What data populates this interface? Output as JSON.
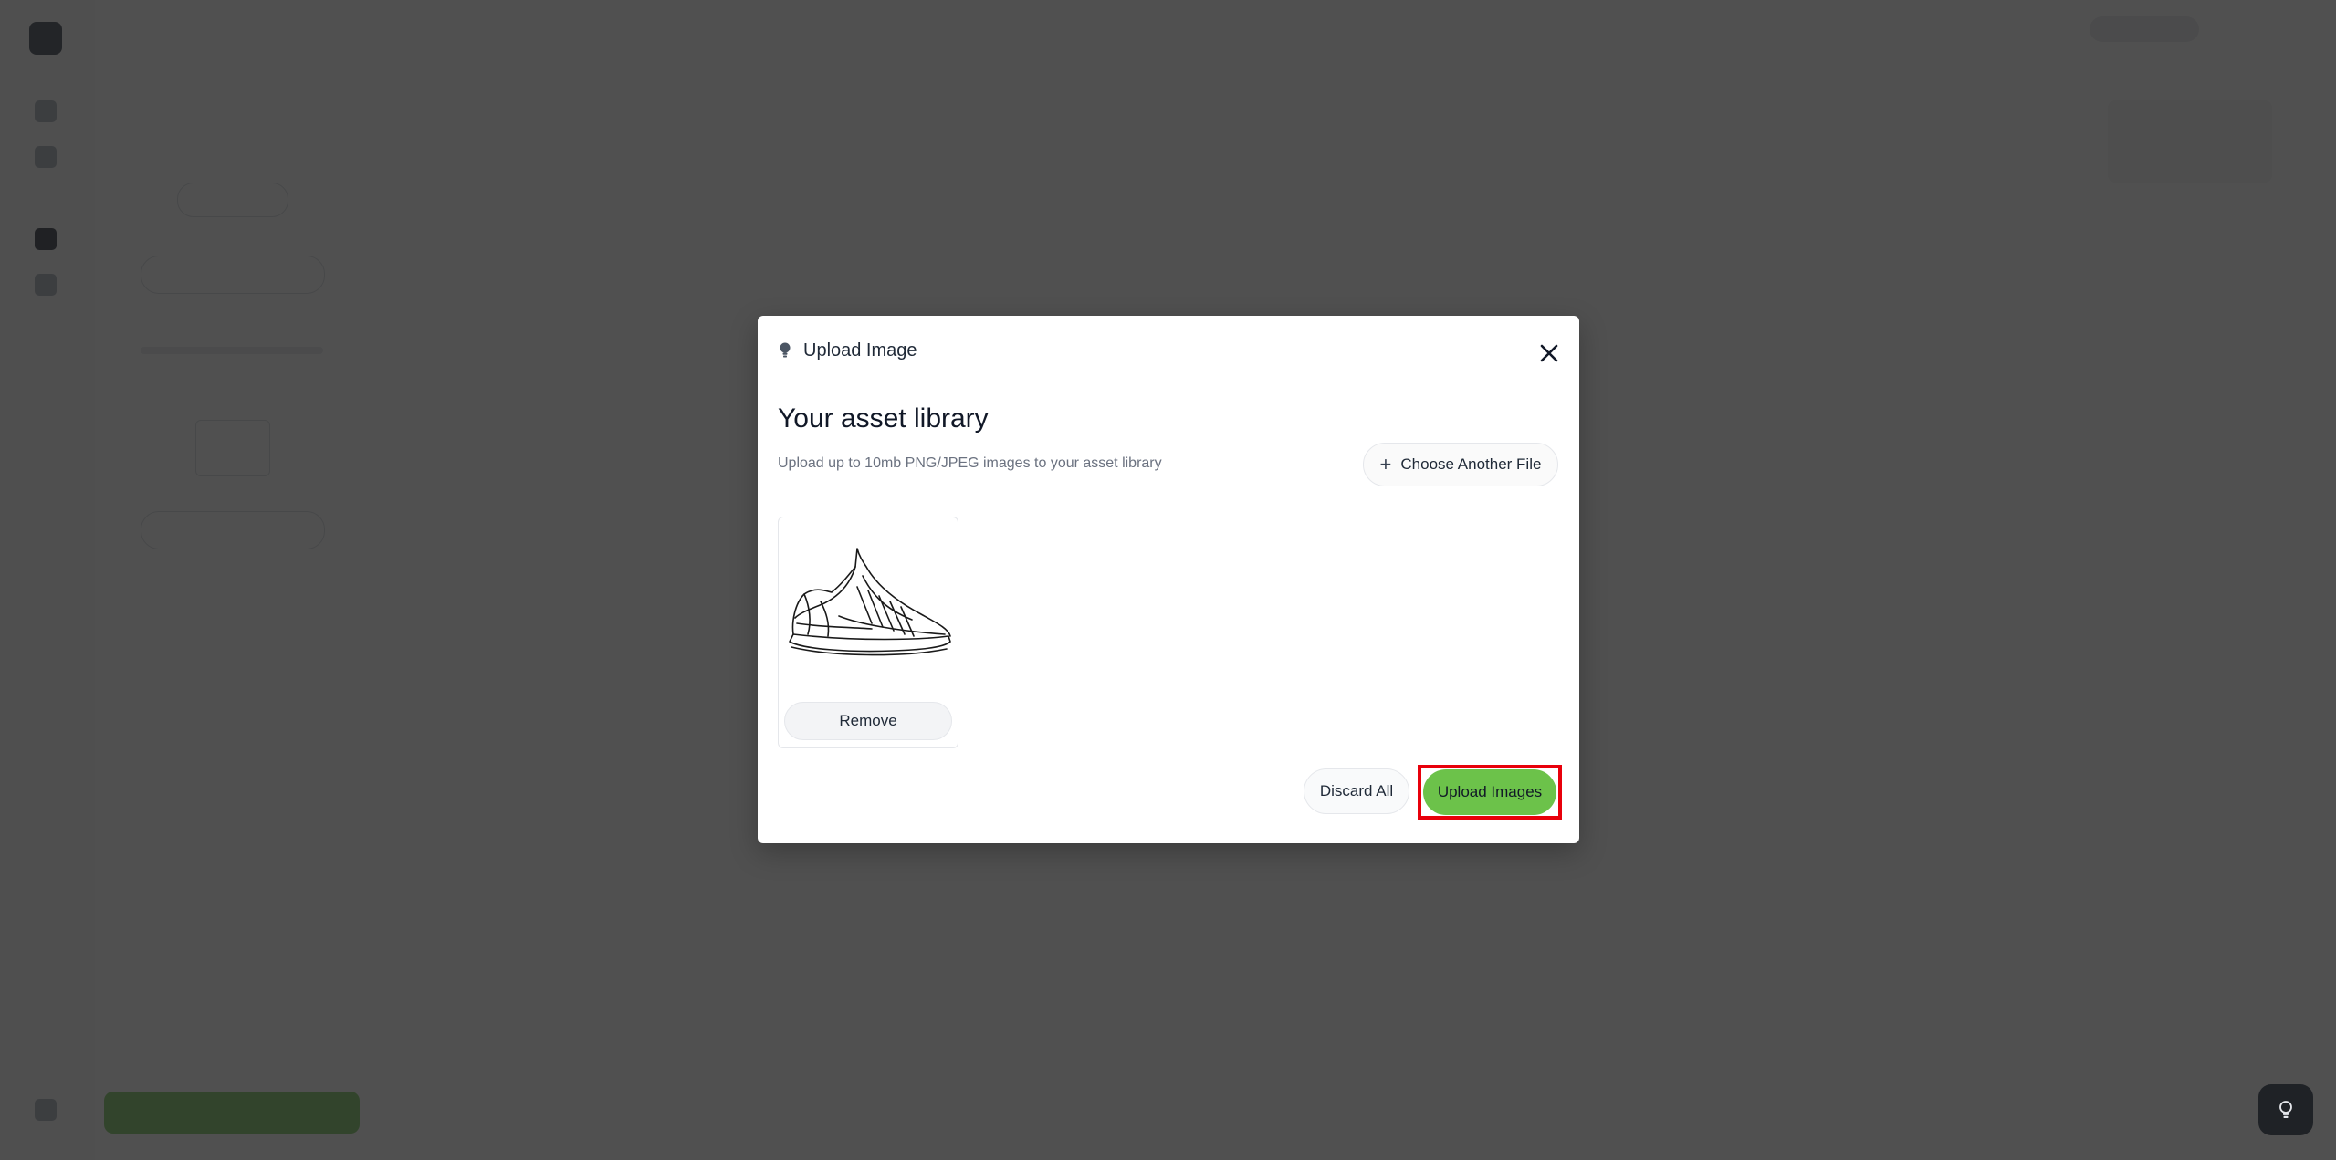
{
  "modal": {
    "header_title": "Upload Image",
    "library_title": "Your asset library",
    "library_description": "Upload up to 10mb PNG/JPEG images to your asset library",
    "choose_file_label": "Choose Another File",
    "remove_label": "Remove",
    "discard_label": "Discard All",
    "upload_label": "Upload Images"
  },
  "theme": {
    "accent_green": "#6cc24a",
    "highlight_red": "#e8000b",
    "overlay": "rgba(36,36,36,0.80)"
  },
  "icons": {
    "header": "bulb-icon",
    "close": "close-icon",
    "choose": "plus-icon",
    "fab": "bulb-icon"
  }
}
